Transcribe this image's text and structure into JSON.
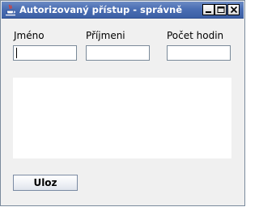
{
  "window": {
    "title": "Autorizovaný přístup - správně",
    "icon": "java-cup-icon",
    "controls": [
      "minimize-icon",
      "maximize-icon",
      "close-icon"
    ],
    "title_color": "#ffffff",
    "titlebar_color": "#4a6eb3"
  },
  "form": {
    "first_name_label": "Jméno",
    "last_name_label": "Příjmeni",
    "hours_label": "Počet hodin",
    "first_name_value": "",
    "last_name_value": "",
    "hours_value": "",
    "notes_value": ""
  },
  "actions": {
    "save_label": "Uloz"
  }
}
